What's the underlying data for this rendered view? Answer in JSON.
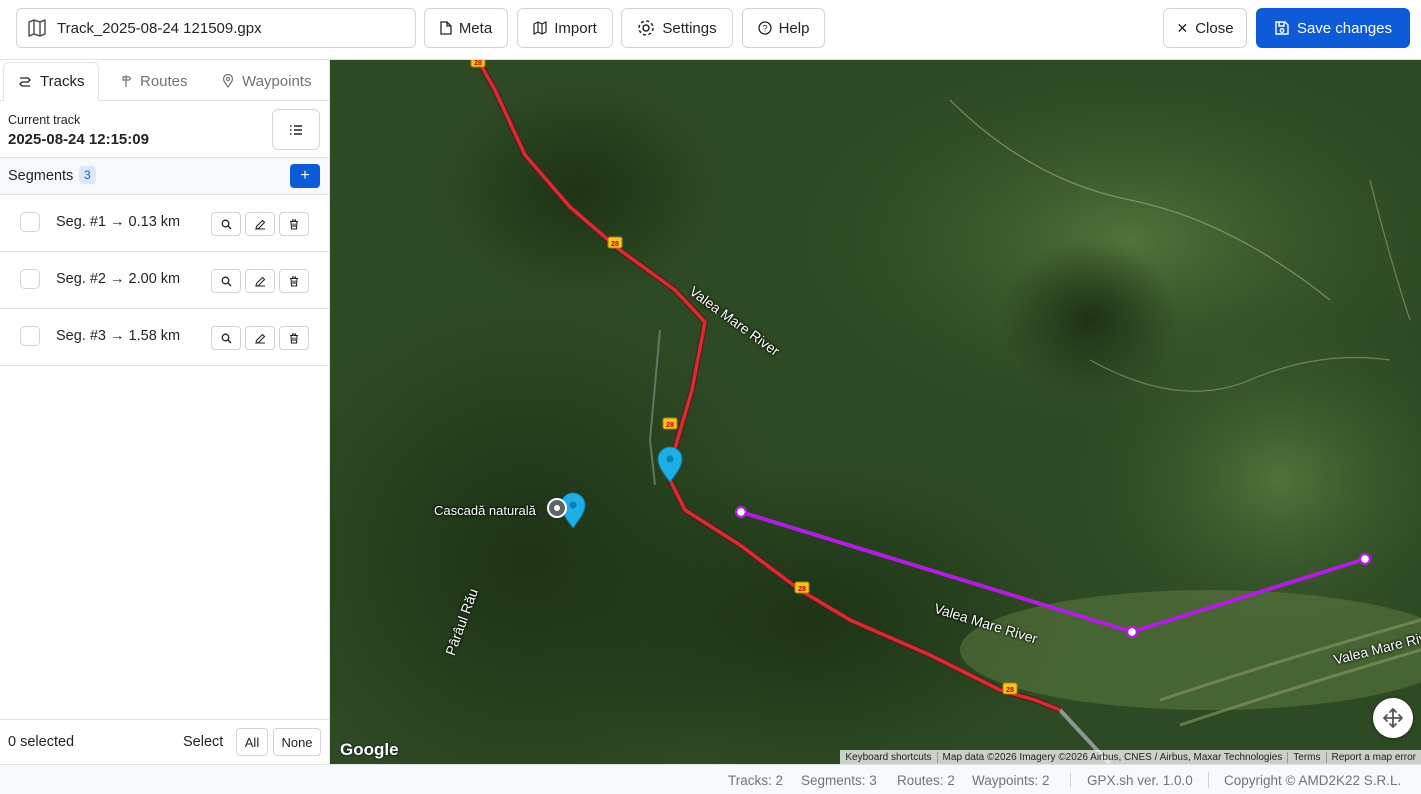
{
  "toolbar": {
    "file_name": "Track_2025-08-24 121509.gpx",
    "meta_label": "Meta",
    "import_label": "Import",
    "settings_label": "Settings",
    "help_label": "Help",
    "close_label": "Close",
    "save_label": "Save changes"
  },
  "sidebar": {
    "tabs": [
      {
        "label": "Tracks",
        "active": true
      },
      {
        "label": "Routes",
        "active": false
      },
      {
        "label": "Waypoints",
        "active": false
      }
    ],
    "current_label": "Current track",
    "current_value": "2025-08-24 12:15:09",
    "segments_label": "Segments",
    "segments_count": "3",
    "add_label": "+",
    "segments": [
      {
        "label": "Seg. #1 → 0.13 km"
      },
      {
        "label": "Seg. #2 → 2.00 km"
      },
      {
        "label": "Seg. #3 → 1.58 km"
      }
    ],
    "selected_text": "0 selected",
    "select_label": "Select",
    "all_label": "All",
    "none_label": "None"
  },
  "map": {
    "labels": {
      "river1": "Valea Mare River",
      "river2": "Valea Mare River",
      "river3": "Valea Mare River",
      "stream": "Pârâul Rău",
      "waterfall": "Cascadă naturală",
      "road_number": "28"
    },
    "google": "Google",
    "attribution": [
      "Keyboard shortcuts",
      "Map data ©2026 Imagery ©2026 Airbus, CNES / Airbus, Maxar Technologies",
      "Terms",
      "Report a map error"
    ],
    "colors": {
      "track": "#d03030",
      "route": "#b01ee0",
      "marker": "#1eaee8"
    }
  },
  "status": {
    "tracks": "Tracks: 2",
    "segments": "Segments: 3",
    "routes": "Routes: 2",
    "waypoints": "Waypoints: 2",
    "version": "GPX.sh ver. 1.0.0",
    "copyright": "Copyright © AMD2K22 S.R.L."
  }
}
